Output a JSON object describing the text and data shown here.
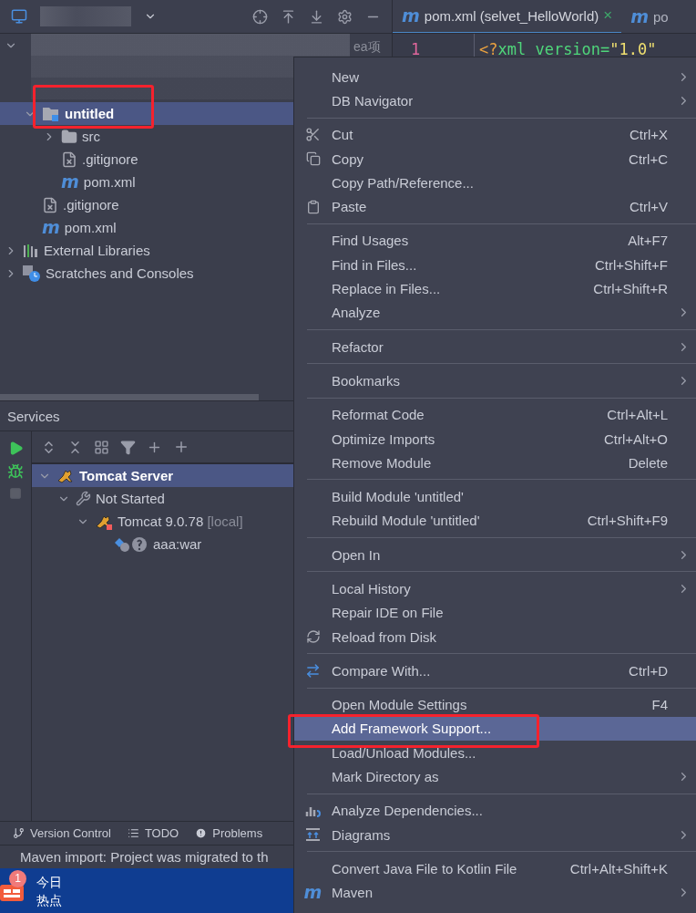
{
  "project_panel": {
    "partial_label": "ea项",
    "tree": [
      {
        "kind": "redacted",
        "expanded": true,
        "children": [
          {
            "label": "untitled",
            "kind": "module",
            "expanded": true,
            "selected": true,
            "children": [
              {
                "label": "src",
                "kind": "folder",
                "expanded": false,
                "selected": false
              },
              {
                "label": ".gitignore",
                "kind": "ignore",
                "selected": false
              },
              {
                "label": "pom.xml",
                "kind": "maven",
                "glyph": "m",
                "selected": false
              }
            ]
          },
          {
            "label": ".gitignore",
            "kind": "ignore",
            "selected": false
          },
          {
            "label": "pom.xml",
            "kind": "maven",
            "glyph": "m",
            "selected": false
          }
        ]
      },
      {
        "label": "External Libraries",
        "kind": "libraries",
        "expanded": false,
        "selected": false
      },
      {
        "label": "Scratches and Consoles",
        "kind": "scratches",
        "expanded": false,
        "selected": false
      }
    ]
  },
  "editor": {
    "tabs": [
      {
        "glyph": "m",
        "label": "pom.xml (selvet_HelloWorld)",
        "close": "×",
        "selected": true
      },
      {
        "glyph": "m",
        "label": "po",
        "selected": false
      }
    ],
    "lines": [
      {
        "number": "1",
        "tokens": [
          {
            "text": "<?",
            "kind": "punct"
          },
          {
            "text": "xml version=",
            "kind": "tag"
          },
          {
            "text": "\"1.0\"",
            "kind": "string"
          }
        ]
      }
    ]
  },
  "services": {
    "title": "Services",
    "tree": [
      {
        "label": "Tomcat Server",
        "kind": "tomcat",
        "expanded": true,
        "selected": true,
        "children": [
          {
            "label": "Not Started",
            "kind": "wrench",
            "expanded": true,
            "selected": false,
            "children": [
              {
                "label": "Tomcat 9.0.78",
                "suffix": "[local]",
                "kind": "tomcat-stopped",
                "expanded": true,
                "selected": false,
                "children": [
                  {
                    "label": "aaa:war",
                    "kind": "artifact",
                    "selected": false
                  }
                ]
              }
            ]
          }
        ]
      }
    ]
  },
  "tool_tabs": [
    {
      "label": "Version Control"
    },
    {
      "label": "TODO"
    },
    {
      "label": "Problems"
    }
  ],
  "status_bar": {
    "message": "Maven import: Project was migrated to th"
  },
  "news_widget": {
    "badge": "1",
    "title": "今日",
    "subtitle": "热点"
  },
  "context_menu": {
    "groups": [
      [
        {
          "label": "New",
          "submenu": true,
          "selected": false
        },
        {
          "label": "DB Navigator",
          "submenu": true,
          "selected": false
        }
      ],
      [
        {
          "label": "Cut",
          "shortcut": "Ctrl+X",
          "submenu": false,
          "selected": false
        },
        {
          "label": "Copy",
          "shortcut": "Ctrl+C",
          "submenu": false,
          "selected": false
        },
        {
          "label": "Copy Path/Reference...",
          "submenu": false,
          "selected": false
        },
        {
          "label": "Paste",
          "shortcut": "Ctrl+V",
          "submenu": false,
          "selected": false
        }
      ],
      [
        {
          "label": "Find Usages",
          "shortcut": "Alt+F7",
          "submenu": false,
          "selected": false
        },
        {
          "label": "Find in Files...",
          "shortcut": "Ctrl+Shift+F",
          "submenu": false,
          "selected": false
        },
        {
          "label": "Replace in Files...",
          "shortcut": "Ctrl+Shift+R",
          "submenu": false,
          "selected": false
        },
        {
          "label": "Analyze",
          "submenu": true,
          "selected": false
        }
      ],
      [
        {
          "label": "Refactor",
          "submenu": true,
          "selected": false
        }
      ],
      [
        {
          "label": "Bookmarks",
          "submenu": true,
          "selected": false
        }
      ],
      [
        {
          "label": "Reformat Code",
          "shortcut": "Ctrl+Alt+L",
          "submenu": false,
          "selected": false
        },
        {
          "label": "Optimize Imports",
          "shortcut": "Ctrl+Alt+O",
          "submenu": false,
          "selected": false
        },
        {
          "label": "Remove Module",
          "shortcut": "Delete",
          "submenu": false,
          "selected": false
        }
      ],
      [
        {
          "label": "Build Module 'untitled'",
          "submenu": false,
          "selected": false
        },
        {
          "label": "Rebuild Module 'untitled'",
          "shortcut": "Ctrl+Shift+F9",
          "submenu": false,
          "selected": false
        }
      ],
      [
        {
          "label": "Open In",
          "submenu": true,
          "selected": false
        }
      ],
      [
        {
          "label": "Local History",
          "submenu": true,
          "selected": false
        },
        {
          "label": "Repair IDE on File",
          "submenu": false,
          "selected": false
        },
        {
          "label": "Reload from Disk",
          "submenu": false,
          "selected": false
        }
      ],
      [
        {
          "label": "Compare With...",
          "shortcut": "Ctrl+D",
          "submenu": false,
          "selected": false
        }
      ],
      [
        {
          "label": "Open Module Settings",
          "shortcut": "F4",
          "submenu": false,
          "selected": false
        },
        {
          "label": "Add Framework Support...",
          "submenu": false,
          "selected": true
        },
        {
          "label": "Load/Unload Modules...",
          "submenu": false,
          "selected": false
        },
        {
          "label": "Mark Directory as",
          "submenu": true,
          "selected": false
        }
      ],
      [
        {
          "label": "Analyze Dependencies...",
          "submenu": false,
          "selected": false
        },
        {
          "label": "Diagrams",
          "submenu": true,
          "selected": false
        }
      ],
      [
        {
          "label": "Convert Java File to Kotlin File",
          "shortcut": "Ctrl+Alt+Shift+K",
          "submenu": false,
          "selected": false
        },
        {
          "label": "Maven",
          "glyph": "m",
          "submenu": true,
          "selected": false
        }
      ]
    ]
  }
}
